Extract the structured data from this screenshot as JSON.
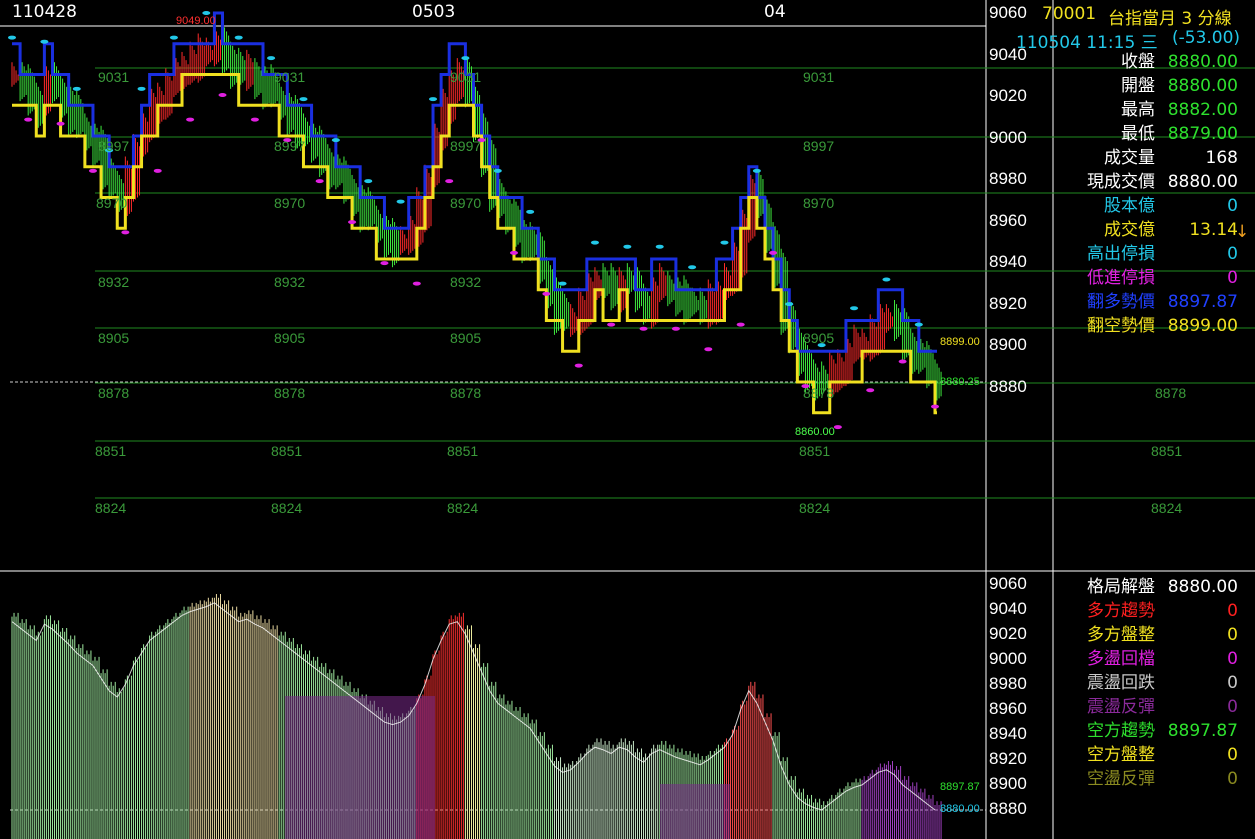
{
  "header": {
    "symbol": "70001",
    "name": "台指當月 3 分線",
    "datetime": "110504 11:15 三",
    "change": "(-53.00)"
  },
  "x_dates": [
    "110428",
    "0503",
    "04"
  ],
  "y_ticks_top": [
    "9060",
    "9040",
    "9020",
    "9000",
    "8980",
    "8960",
    "8940",
    "8920",
    "8900",
    "8880"
  ],
  "y_ticks_bottom": [
    "9060",
    "9040",
    "9020",
    "9000",
    "8980",
    "8960",
    "8940",
    "8920",
    "8900",
    "8880"
  ],
  "levels": [
    "9031",
    "8997",
    "8970",
    "8932",
    "8905",
    "8878",
    "8851",
    "8824"
  ],
  "markers": {
    "high_label": "9049.00",
    "low_label": "8860.00",
    "yellow_right": "8899.00",
    "last_right": "8880.25",
    "bottom_green": "8897.87",
    "bottom_cyan": "8880.00"
  },
  "info_top": [
    {
      "label": "收盤",
      "value": "8880.00",
      "lcolor": "#ffffff",
      "vcolor": "#2ee02e"
    },
    {
      "label": "開盤",
      "value": "8880.00",
      "lcolor": "#ffffff",
      "vcolor": "#2ee02e"
    },
    {
      "label": "最高",
      "value": "8882.00",
      "lcolor": "#ffffff",
      "vcolor": "#2ee02e"
    },
    {
      "label": "最低",
      "value": "8879.00",
      "lcolor": "#ffffff",
      "vcolor": "#2ee02e"
    },
    {
      "label": "成交量",
      "value": "168",
      "lcolor": "#ffffff",
      "vcolor": "#ffffff"
    },
    {
      "label": "現成交價",
      "value": "8880.00",
      "lcolor": "#ffffff",
      "vcolor": "#ffffff"
    },
    {
      "label": "股本億",
      "value": "0",
      "lcolor": "#22c8e8",
      "vcolor": "#22c8e8"
    },
    {
      "label": "成交億",
      "value": "13.14",
      "lcolor": "#f0e020",
      "vcolor": "#f0e020"
    },
    {
      "label": "高出停損",
      "value": "0",
      "lcolor": "#22c8e8",
      "vcolor": "#22c8e8"
    },
    {
      "label": "低進停損",
      "value": "0",
      "lcolor": "#e020e0",
      "vcolor": "#e020e0"
    },
    {
      "label": "翻多勢價",
      "value": "8897.87",
      "lcolor": "#2040ff",
      "vcolor": "#2040ff"
    },
    {
      "label": "翻空勢價",
      "value": "8899.00",
      "lcolor": "#f0e020",
      "vcolor": "#f0e020"
    }
  ],
  "down_arrow": "↓",
  "info_bottom": [
    {
      "label": "格局解盤",
      "value": "8880.00",
      "lcolor": "#ffffff",
      "vcolor": "#ffffff"
    },
    {
      "label": "多方趨勢",
      "value": "0",
      "lcolor": "#ff2020",
      "vcolor": "#ff2020"
    },
    {
      "label": "多方盤整",
      "value": "0",
      "lcolor": "#f0e020",
      "vcolor": "#f0e020"
    },
    {
      "label": "多盪回檔",
      "value": "0",
      "lcolor": "#e020e0",
      "vcolor": "#e020e0"
    },
    {
      "label": "震盪回跌",
      "value": "0",
      "lcolor": "#c8c8c8",
      "vcolor": "#c8c8c8"
    },
    {
      "label": "震盪反彈",
      "value": "0",
      "lcolor": "#8a2a9a",
      "vcolor": "#8a2a9a"
    },
    {
      "label": "空方趨勢",
      "value": "8897.87",
      "lcolor": "#2ee02e",
      "vcolor": "#2ee02e"
    },
    {
      "label": "空方盤整",
      "value": "0",
      "lcolor": "#f0e020",
      "vcolor": "#f0e020"
    },
    {
      "label": "空盪反彈",
      "value": "0",
      "lcolor": "#8a8a20",
      "vcolor": "#8a8a20"
    }
  ],
  "chart_data": {
    "type": "candlestick",
    "y_range": [
      8870,
      9062
    ],
    "close_series": [
      9030,
      9025,
      9020,
      9015,
      9028,
      9024,
      9018,
      9012,
      9005,
      9000,
      8995,
      8985,
      8975,
      8970,
      8980,
      8995,
      9005,
      9015,
      9020,
      9025,
      9030,
      9035,
      9038,
      9040,
      9042,
      9045,
      9040,
      9035,
      9030,
      9032,
      9028,
      9025,
      9020,
      9015,
      9010,
      9005,
      9000,
      8995,
      8990,
      8985,
      8980,
      8975,
      8970,
      8965,
      8960,
      8955,
      8950,
      8948,
      8950,
      8955,
      8965,
      8980,
      9000,
      9015,
      9028,
      9030,
      9020,
      9005,
      8990,
      8975,
      8965,
      8960,
      8955,
      8950,
      8945,
      8935,
      8925,
      8915,
      8910,
      8912,
      8918,
      8925,
      8930,
      8928,
      8925,
      8930,
      8928,
      8922,
      8918,
      8925,
      8928,
      8925,
      8922,
      8920,
      8918,
      8916,
      8920,
      8925,
      8930,
      8940,
      8960,
      8975,
      8965,
      8950,
      8935,
      8915,
      8900,
      8890,
      8885,
      8882,
      8880,
      8885,
      8890,
      8895,
      8898,
      8900,
      8905,
      8910,
      8912,
      8908,
      8900,
      8895,
      8890,
      8885,
      8880
    ],
    "y_ticks": [
      9060,
      9040,
      9020,
      9000,
      8980,
      8960,
      8940,
      8920,
      8900,
      8880
    ],
    "levels": [
      9031,
      8997,
      8970,
      8932,
      8905,
      8878,
      8851,
      8824
    ]
  }
}
